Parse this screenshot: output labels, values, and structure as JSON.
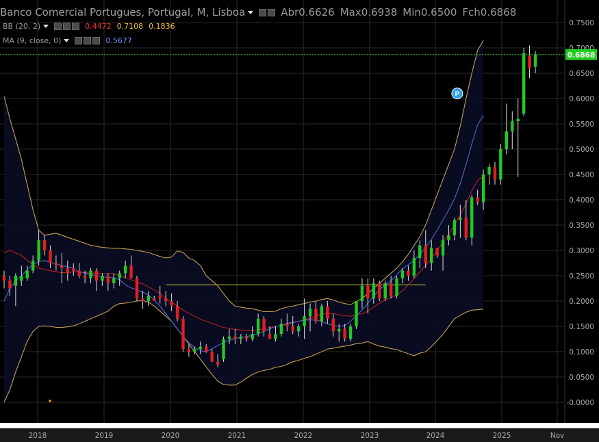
{
  "header": {
    "title": "Banco Comercial Portugues, Portugal, M, Lisboa",
    "ohlc": [
      {
        "label": "Abr",
        "value": "0.6626"
      },
      {
        "label": "Max",
        "value": "0.6938"
      },
      {
        "label": "Min",
        "value": "0.6500"
      },
      {
        "label": "Fch",
        "value": "0.6868"
      }
    ],
    "indicators": [
      {
        "label": "BB (20, 2)",
        "values": [
          {
            "text": "0.4472",
            "color": "#ff3030"
          },
          {
            "text": "0.7108",
            "color": "#f0c040"
          },
          {
            "text": "0.1836",
            "color": "#f0c040"
          }
        ]
      },
      {
        "label": "MA (9, close, 0)",
        "values": [
          {
            "text": "0.5677",
            "color": "#6a9cff"
          }
        ]
      }
    ]
  },
  "colors": {
    "background": "#000000",
    "grid": "#2a2a2a",
    "up": "#22c922",
    "down": "#e02020",
    "bb_band": "#c8a050",
    "bb_mid": "#c02020",
    "ma": "#4a6ad0",
    "hline": "#b8b840",
    "last_price_line": "#22c922",
    "axis_text": "#aaaaaa",
    "bottom_axis_bg": "#1a1a1a"
  },
  "chart_data": {
    "type": "candlestick",
    "title": "Banco Comercial Portugues, Portugal, M, Lisboa",
    "ylim": [
      -0.01,
      0.76
    ],
    "y_ticks": [
      "0.7500",
      "0.7000",
      "0.6500",
      "0.6000",
      "0.5500",
      "0.5000",
      "0.4500",
      "0.4000",
      "0.3500",
      "0.3000",
      "0.2500",
      "0.2000",
      "0.1500",
      "0.1000",
      "0.0500",
      "-0.0000"
    ],
    "x_labels": [
      "2018",
      "2019",
      "2020",
      "2021",
      "2022",
      "2023",
      "2024",
      "2025",
      "Nov"
    ],
    "last_price": "0.6868",
    "horizontal_line": 0.232,
    "marker": {
      "text": "P",
      "value": 0.61
    },
    "series_bb_upper": [
      0.604,
      0.56,
      0.52,
      0.48,
      0.43,
      0.38,
      0.34,
      0.33,
      0.332,
      0.334,
      0.33,
      0.326,
      0.322,
      0.318,
      0.314,
      0.31,
      0.308,
      0.306,
      0.305,
      0.304,
      0.304,
      0.303,
      0.302,
      0.3,
      0.298,
      0.296,
      0.292,
      0.288,
      0.285,
      0.287,
      0.299,
      0.296,
      0.285,
      0.28,
      0.27,
      0.25,
      0.24,
      0.23,
      0.215,
      0.2,
      0.19,
      0.188,
      0.186,
      0.185,
      0.182,
      0.179,
      0.179,
      0.18,
      0.185,
      0.188,
      0.19,
      0.193,
      0.195,
      0.198,
      0.2,
      0.203,
      0.205,
      0.202,
      0.198,
      0.195,
      0.193,
      0.199,
      0.205,
      0.215,
      0.225,
      0.235,
      0.245,
      0.255,
      0.265,
      0.278,
      0.292,
      0.31,
      0.327,
      0.35,
      0.38,
      0.41,
      0.44,
      0.47,
      0.5,
      0.545,
      0.6,
      0.65,
      0.695,
      0.715
    ],
    "series_bb_lower": [
      0.0,
      0.025,
      0.06,
      0.09,
      0.12,
      0.14,
      0.15,
      0.151,
      0.15,
      0.148,
      0.148,
      0.149,
      0.151,
      0.155,
      0.16,
      0.165,
      0.17,
      0.175,
      0.18,
      0.19,
      0.195,
      0.196,
      0.198,
      0.2,
      0.201,
      0.198,
      0.19,
      0.18,
      0.17,
      0.16,
      0.145,
      0.13,
      0.115,
      0.1,
      0.085,
      0.07,
      0.055,
      0.042,
      0.035,
      0.034,
      0.034,
      0.04,
      0.048,
      0.055,
      0.06,
      0.063,
      0.065,
      0.069,
      0.071,
      0.075,
      0.08,
      0.083,
      0.087,
      0.09,
      0.095,
      0.1,
      0.105,
      0.107,
      0.109,
      0.111,
      0.113,
      0.116,
      0.117,
      0.12,
      0.115,
      0.111,
      0.109,
      0.106,
      0.104,
      0.1,
      0.096,
      0.092,
      0.097,
      0.1,
      0.11,
      0.122,
      0.134,
      0.15,
      0.165,
      0.172,
      0.178,
      0.182,
      0.183,
      0.184
    ],
    "series_bb_mid": [
      0.296,
      0.3,
      0.295,
      0.29,
      0.28,
      0.272,
      0.265,
      0.262,
      0.26,
      0.258,
      0.256,
      0.256,
      0.258,
      0.258,
      0.256,
      0.255,
      0.254,
      0.254,
      0.254,
      0.254,
      0.25,
      0.246,
      0.242,
      0.238,
      0.234,
      0.228,
      0.222,
      0.215,
      0.206,
      0.198,
      0.19,
      0.182,
      0.176,
      0.17,
      0.164,
      0.16,
      0.156,
      0.152,
      0.148,
      0.146,
      0.144,
      0.143,
      0.142,
      0.142,
      0.143,
      0.145,
      0.148,
      0.15,
      0.152,
      0.154,
      0.157,
      0.16,
      0.163,
      0.166,
      0.17,
      0.174,
      0.176,
      0.175,
      0.173,
      0.171,
      0.17,
      0.172,
      0.175,
      0.18,
      0.188,
      0.196,
      0.202,
      0.207,
      0.212,
      0.22,
      0.232,
      0.244,
      0.258,
      0.27,
      0.284,
      0.3,
      0.316,
      0.332,
      0.35,
      0.37,
      0.392,
      0.418,
      0.438,
      0.447
    ],
    "series_ma": [
      0.2,
      0.225,
      0.24,
      0.25,
      0.262,
      0.272,
      0.278,
      0.28,
      0.276,
      0.274,
      0.27,
      0.268,
      0.264,
      0.258,
      0.255,
      0.252,
      0.25,
      0.248,
      0.247,
      0.246,
      0.242,
      0.232,
      0.226,
      0.222,
      0.218,
      0.212,
      0.202,
      0.19,
      0.175,
      0.16,
      0.145,
      0.13,
      0.118,
      0.108,
      0.102,
      0.1,
      0.106,
      0.112,
      0.118,
      0.122,
      0.126,
      0.128,
      0.13,
      0.132,
      0.136,
      0.14,
      0.145,
      0.15,
      0.152,
      0.156,
      0.158,
      0.16,
      0.162,
      0.163,
      0.162,
      0.16,
      0.155,
      0.152,
      0.15,
      0.152,
      0.16,
      0.172,
      0.182,
      0.196,
      0.21,
      0.222,
      0.232,
      0.24,
      0.252,
      0.264,
      0.272,
      0.28,
      0.292,
      0.306,
      0.322,
      0.34,
      0.36,
      0.38,
      0.402,
      0.432,
      0.47,
      0.51,
      0.548,
      0.567
    ],
    "candles": [
      [
        0.25,
        0.26,
        0.225,
        0.24
      ],
      [
        0.24,
        0.25,
        0.21,
        0.225
      ],
      [
        0.23,
        0.255,
        0.19,
        0.25
      ],
      [
        0.24,
        0.27,
        0.23,
        0.25
      ],
      [
        0.245,
        0.27,
        0.24,
        0.26
      ],
      [
        0.26,
        0.29,
        0.255,
        0.28
      ],
      [
        0.28,
        0.34,
        0.27,
        0.32
      ],
      [
        0.32,
        0.33,
        0.29,
        0.3
      ],
      [
        0.3,
        0.31,
        0.265,
        0.275
      ],
      [
        0.275,
        0.29,
        0.26,
        0.27
      ],
      [
        0.27,
        0.295,
        0.235,
        0.265
      ],
      [
        0.265,
        0.28,
        0.24,
        0.255
      ],
      [
        0.265,
        0.275,
        0.25,
        0.26
      ],
      [
        0.26,
        0.275,
        0.245,
        0.25
      ],
      [
        0.25,
        0.26,
        0.235,
        0.245
      ],
      [
        0.245,
        0.265,
        0.235,
        0.26
      ],
      [
        0.26,
        0.265,
        0.22,
        0.24
      ],
      [
        0.24,
        0.255,
        0.23,
        0.25
      ],
      [
        0.25,
        0.255,
        0.22,
        0.235
      ],
      [
        0.235,
        0.255,
        0.225,
        0.245
      ],
      [
        0.245,
        0.26,
        0.23,
        0.255
      ],
      [
        0.255,
        0.28,
        0.245,
        0.27
      ],
      [
        0.27,
        0.29,
        0.245,
        0.245
      ],
      [
        0.245,
        0.25,
        0.2,
        0.205
      ],
      [
        0.205,
        0.22,
        0.185,
        0.2
      ],
      [
        0.2,
        0.22,
        0.19,
        0.21
      ],
      [
        0.205,
        0.21,
        0.2,
        0.2
      ],
      [
        0.21,
        0.23,
        0.195,
        0.205
      ],
      [
        0.205,
        0.22,
        0.19,
        0.2
      ],
      [
        0.2,
        0.215,
        0.18,
        0.19
      ],
      [
        0.19,
        0.2,
        0.16,
        0.165
      ],
      [
        0.165,
        0.17,
        0.1,
        0.105
      ],
      [
        0.105,
        0.115,
        0.09,
        0.1
      ],
      [
        0.1,
        0.11,
        0.095,
        0.105
      ],
      [
        0.105,
        0.12,
        0.095,
        0.11
      ],
      [
        0.11,
        0.115,
        0.098,
        0.1
      ],
      [
        0.1,
        0.105,
        0.08,
        0.08
      ],
      [
        0.08,
        0.095,
        0.07,
        0.075
      ],
      [
        0.085,
        0.13,
        0.08,
        0.125
      ],
      [
        0.125,
        0.145,
        0.115,
        0.13
      ],
      [
        0.13,
        0.145,
        0.115,
        0.125
      ],
      [
        0.125,
        0.135,
        0.115,
        0.13
      ],
      [
        0.13,
        0.135,
        0.12,
        0.125
      ],
      [
        0.125,
        0.15,
        0.12,
        0.135
      ],
      [
        0.135,
        0.175,
        0.13,
        0.165
      ],
      [
        0.165,
        0.17,
        0.13,
        0.14
      ],
      [
        0.135,
        0.15,
        0.125,
        0.125
      ],
      [
        0.125,
        0.15,
        0.12,
        0.135
      ],
      [
        0.135,
        0.165,
        0.13,
        0.155
      ],
      [
        0.155,
        0.175,
        0.14,
        0.15
      ],
      [
        0.15,
        0.17,
        0.135,
        0.14
      ],
      [
        0.14,
        0.155,
        0.13,
        0.15
      ],
      [
        0.15,
        0.205,
        0.125,
        0.17
      ],
      [
        0.17,
        0.195,
        0.14,
        0.185
      ],
      [
        0.185,
        0.2,
        0.155,
        0.16
      ],
      [
        0.16,
        0.195,
        0.15,
        0.19
      ],
      [
        0.19,
        0.2,
        0.155,
        0.165
      ],
      [
        0.165,
        0.175,
        0.13,
        0.14
      ],
      [
        0.14,
        0.155,
        0.12,
        0.145
      ],
      [
        0.145,
        0.155,
        0.12,
        0.125
      ],
      [
        0.125,
        0.155,
        0.12,
        0.15
      ],
      [
        0.15,
        0.2,
        0.145,
        0.2
      ],
      [
        0.2,
        0.245,
        0.185,
        0.23
      ],
      [
        0.23,
        0.245,
        0.175,
        0.205
      ],
      [
        0.205,
        0.245,
        0.195,
        0.235
      ],
      [
        0.235,
        0.24,
        0.2,
        0.205
      ],
      [
        0.205,
        0.24,
        0.2,
        0.235
      ],
      [
        0.235,
        0.25,
        0.205,
        0.21
      ],
      [
        0.21,
        0.25,
        0.205,
        0.245
      ],
      [
        0.245,
        0.265,
        0.235,
        0.26
      ],
      [
        0.26,
        0.27,
        0.24,
        0.25
      ],
      [
        0.25,
        0.3,
        0.245,
        0.285
      ],
      [
        0.285,
        0.32,
        0.265,
        0.31
      ],
      [
        0.31,
        0.34,
        0.265,
        0.275
      ],
      [
        0.275,
        0.32,
        0.26,
        0.305
      ],
      [
        0.305,
        0.305,
        0.285,
        0.29
      ],
      [
        0.29,
        0.33,
        0.26,
        0.32
      ],
      [
        0.32,
        0.35,
        0.31,
        0.33
      ],
      [
        0.33,
        0.365,
        0.32,
        0.36
      ],
      [
        0.36,
        0.39,
        0.325,
        0.365
      ],
      [
        0.365,
        0.4,
        0.32,
        0.325
      ],
      [
        0.325,
        0.41,
        0.31,
        0.405
      ],
      [
        0.405,
        0.42,
        0.39,
        0.395
      ],
      [
        0.395,
        0.46,
        0.38,
        0.45
      ],
      [
        0.45,
        0.47,
        0.43,
        0.465
      ],
      [
        0.465,
        0.475,
        0.43,
        0.44
      ],
      [
        0.44,
        0.51,
        0.43,
        0.5
      ],
      [
        0.5,
        0.59,
        0.49,
        0.535
      ],
      [
        0.535,
        0.575,
        0.5,
        0.555
      ],
      [
        0.555,
        0.6,
        0.445,
        0.56
      ],
      [
        0.57,
        0.7,
        0.565,
        0.69
      ],
      [
        0.685,
        0.705,
        0.64,
        0.66
      ],
      [
        0.6626,
        0.6938,
        0.65,
        0.6868
      ]
    ]
  }
}
